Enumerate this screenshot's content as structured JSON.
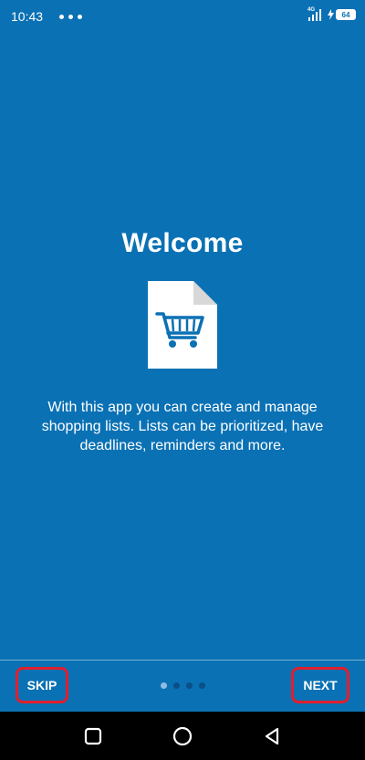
{
  "status_bar": {
    "time": "10:43",
    "network": "4G",
    "battery": "64"
  },
  "onboarding": {
    "title": "Welcome",
    "illustration": "shopping-cart-document-icon",
    "description": "With this app you can create and manage shopping lists. Lists can be prioritized, have deadlines, reminders and more.",
    "page_index": 1,
    "page_count": 4
  },
  "bottom_bar": {
    "skip_label": "SKIP",
    "next_label": "NEXT"
  },
  "nav_bar": {
    "items": [
      "square-icon",
      "circle-home-icon",
      "triangle-back-icon"
    ]
  },
  "colors": {
    "background": "#0a71b4",
    "text": "#ffffff",
    "highlight_border": "#e0202e"
  }
}
